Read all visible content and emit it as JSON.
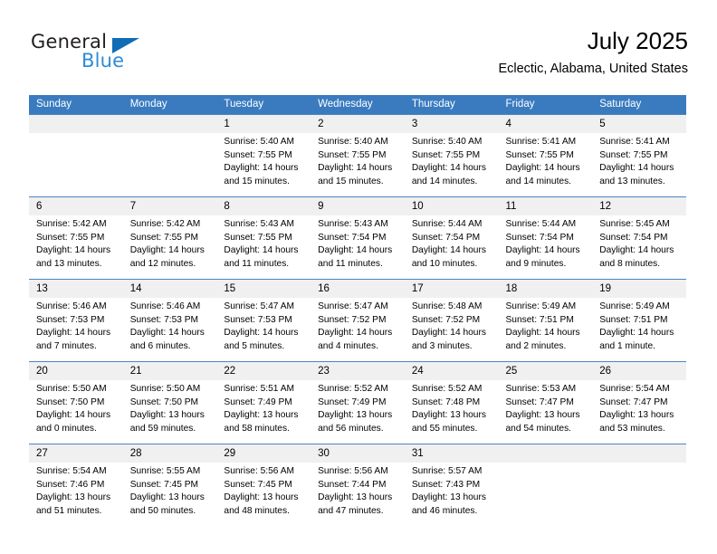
{
  "brand": {
    "name_top": "General",
    "name_bottom": "Blue",
    "accent_color": "#2e8bd6",
    "triangle_color": "#0f6cb5"
  },
  "header": {
    "title": "July 2025",
    "subtitle": "Eclectic, Alabama, United States"
  },
  "theme": {
    "header_row_bg": "#3a7bbf",
    "header_row_text": "#ffffff",
    "daynum_bg": "#f0f0f0",
    "row_border": "#4a85c4"
  },
  "weekday_headers": [
    "Sunday",
    "Monday",
    "Tuesday",
    "Wednesday",
    "Thursday",
    "Friday",
    "Saturday"
  ],
  "weeks": [
    [
      {
        "empty": true
      },
      {
        "empty": true
      },
      {
        "day": "1",
        "sunrise": "Sunrise: 5:40 AM",
        "sunset": "Sunset: 7:55 PM",
        "daylight_line1": "Daylight: 14 hours",
        "daylight_line2": "and 15 minutes."
      },
      {
        "day": "2",
        "sunrise": "Sunrise: 5:40 AM",
        "sunset": "Sunset: 7:55 PM",
        "daylight_line1": "Daylight: 14 hours",
        "daylight_line2": "and 15 minutes."
      },
      {
        "day": "3",
        "sunrise": "Sunrise: 5:40 AM",
        "sunset": "Sunset: 7:55 PM",
        "daylight_line1": "Daylight: 14 hours",
        "daylight_line2": "and 14 minutes."
      },
      {
        "day": "4",
        "sunrise": "Sunrise: 5:41 AM",
        "sunset": "Sunset: 7:55 PM",
        "daylight_line1": "Daylight: 14 hours",
        "daylight_line2": "and 14 minutes."
      },
      {
        "day": "5",
        "sunrise": "Sunrise: 5:41 AM",
        "sunset": "Sunset: 7:55 PM",
        "daylight_line1": "Daylight: 14 hours",
        "daylight_line2": "and 13 minutes."
      }
    ],
    [
      {
        "day": "6",
        "sunrise": "Sunrise: 5:42 AM",
        "sunset": "Sunset: 7:55 PM",
        "daylight_line1": "Daylight: 14 hours",
        "daylight_line2": "and 13 minutes."
      },
      {
        "day": "7",
        "sunrise": "Sunrise: 5:42 AM",
        "sunset": "Sunset: 7:55 PM",
        "daylight_line1": "Daylight: 14 hours",
        "daylight_line2": "and 12 minutes."
      },
      {
        "day": "8",
        "sunrise": "Sunrise: 5:43 AM",
        "sunset": "Sunset: 7:55 PM",
        "daylight_line1": "Daylight: 14 hours",
        "daylight_line2": "and 11 minutes."
      },
      {
        "day": "9",
        "sunrise": "Sunrise: 5:43 AM",
        "sunset": "Sunset: 7:54 PM",
        "daylight_line1": "Daylight: 14 hours",
        "daylight_line2": "and 11 minutes."
      },
      {
        "day": "10",
        "sunrise": "Sunrise: 5:44 AM",
        "sunset": "Sunset: 7:54 PM",
        "daylight_line1": "Daylight: 14 hours",
        "daylight_line2": "and 10 minutes."
      },
      {
        "day": "11",
        "sunrise": "Sunrise: 5:44 AM",
        "sunset": "Sunset: 7:54 PM",
        "daylight_line1": "Daylight: 14 hours",
        "daylight_line2": "and 9 minutes."
      },
      {
        "day": "12",
        "sunrise": "Sunrise: 5:45 AM",
        "sunset": "Sunset: 7:54 PM",
        "daylight_line1": "Daylight: 14 hours",
        "daylight_line2": "and 8 minutes."
      }
    ],
    [
      {
        "day": "13",
        "sunrise": "Sunrise: 5:46 AM",
        "sunset": "Sunset: 7:53 PM",
        "daylight_line1": "Daylight: 14 hours",
        "daylight_line2": "and 7 minutes."
      },
      {
        "day": "14",
        "sunrise": "Sunrise: 5:46 AM",
        "sunset": "Sunset: 7:53 PM",
        "daylight_line1": "Daylight: 14 hours",
        "daylight_line2": "and 6 minutes."
      },
      {
        "day": "15",
        "sunrise": "Sunrise: 5:47 AM",
        "sunset": "Sunset: 7:53 PM",
        "daylight_line1": "Daylight: 14 hours",
        "daylight_line2": "and 5 minutes."
      },
      {
        "day": "16",
        "sunrise": "Sunrise: 5:47 AM",
        "sunset": "Sunset: 7:52 PM",
        "daylight_line1": "Daylight: 14 hours",
        "daylight_line2": "and 4 minutes."
      },
      {
        "day": "17",
        "sunrise": "Sunrise: 5:48 AM",
        "sunset": "Sunset: 7:52 PM",
        "daylight_line1": "Daylight: 14 hours",
        "daylight_line2": "and 3 minutes."
      },
      {
        "day": "18",
        "sunrise": "Sunrise: 5:49 AM",
        "sunset": "Sunset: 7:51 PM",
        "daylight_line1": "Daylight: 14 hours",
        "daylight_line2": "and 2 minutes."
      },
      {
        "day": "19",
        "sunrise": "Sunrise: 5:49 AM",
        "sunset": "Sunset: 7:51 PM",
        "daylight_line1": "Daylight: 14 hours",
        "daylight_line2": "and 1 minute."
      }
    ],
    [
      {
        "day": "20",
        "sunrise": "Sunrise: 5:50 AM",
        "sunset": "Sunset: 7:50 PM",
        "daylight_line1": "Daylight: 14 hours",
        "daylight_line2": "and 0 minutes."
      },
      {
        "day": "21",
        "sunrise": "Sunrise: 5:50 AM",
        "sunset": "Sunset: 7:50 PM",
        "daylight_line1": "Daylight: 13 hours",
        "daylight_line2": "and 59 minutes."
      },
      {
        "day": "22",
        "sunrise": "Sunrise: 5:51 AM",
        "sunset": "Sunset: 7:49 PM",
        "daylight_line1": "Daylight: 13 hours",
        "daylight_line2": "and 58 minutes."
      },
      {
        "day": "23",
        "sunrise": "Sunrise: 5:52 AM",
        "sunset": "Sunset: 7:49 PM",
        "daylight_line1": "Daylight: 13 hours",
        "daylight_line2": "and 56 minutes."
      },
      {
        "day": "24",
        "sunrise": "Sunrise: 5:52 AM",
        "sunset": "Sunset: 7:48 PM",
        "daylight_line1": "Daylight: 13 hours",
        "daylight_line2": "and 55 minutes."
      },
      {
        "day": "25",
        "sunrise": "Sunrise: 5:53 AM",
        "sunset": "Sunset: 7:47 PM",
        "daylight_line1": "Daylight: 13 hours",
        "daylight_line2": "and 54 minutes."
      },
      {
        "day": "26",
        "sunrise": "Sunrise: 5:54 AM",
        "sunset": "Sunset: 7:47 PM",
        "daylight_line1": "Daylight: 13 hours",
        "daylight_line2": "and 53 minutes."
      }
    ],
    [
      {
        "day": "27",
        "sunrise": "Sunrise: 5:54 AM",
        "sunset": "Sunset: 7:46 PM",
        "daylight_line1": "Daylight: 13 hours",
        "daylight_line2": "and 51 minutes."
      },
      {
        "day": "28",
        "sunrise": "Sunrise: 5:55 AM",
        "sunset": "Sunset: 7:45 PM",
        "daylight_line1": "Daylight: 13 hours",
        "daylight_line2": "and 50 minutes."
      },
      {
        "day": "29",
        "sunrise": "Sunrise: 5:56 AM",
        "sunset": "Sunset: 7:45 PM",
        "daylight_line1": "Daylight: 13 hours",
        "daylight_line2": "and 48 minutes."
      },
      {
        "day": "30",
        "sunrise": "Sunrise: 5:56 AM",
        "sunset": "Sunset: 7:44 PM",
        "daylight_line1": "Daylight: 13 hours",
        "daylight_line2": "and 47 minutes."
      },
      {
        "day": "31",
        "sunrise": "Sunrise: 5:57 AM",
        "sunset": "Sunset: 7:43 PM",
        "daylight_line1": "Daylight: 13 hours",
        "daylight_line2": "and 46 minutes."
      },
      {
        "empty": true
      },
      {
        "empty": true
      }
    ]
  ]
}
